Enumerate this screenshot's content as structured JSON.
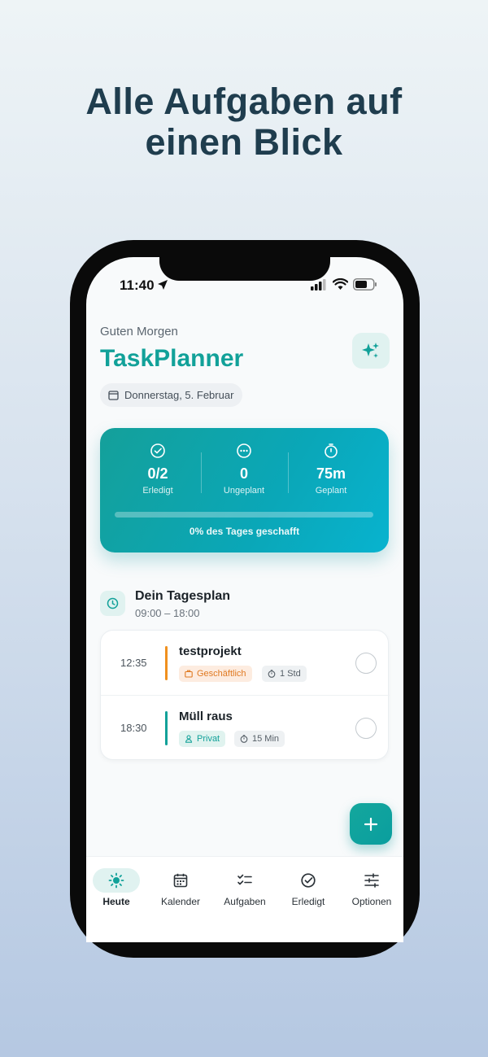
{
  "headline": {
    "line1": "Alle Aufgaben auf",
    "line2": "einen Blick"
  },
  "status_bar": {
    "time": "11:40"
  },
  "header": {
    "greeting": "Guten Morgen",
    "title": "TaskPlanner",
    "date": "Donnerstag, 5. Februar"
  },
  "stats": {
    "done": {
      "value": "0/2",
      "label": "Erledigt"
    },
    "unplanned": {
      "value": "0",
      "label": "Ungeplant"
    },
    "planned": {
      "value": "75m",
      "label": "Geplant"
    },
    "progress_percent": 0,
    "progress_text": "0% des Tages geschafft"
  },
  "day_plan": {
    "title": "Dein Tagesplan",
    "range": "09:00 – 18:00",
    "tasks": [
      {
        "time": "12:35",
        "name": "testprojekt",
        "category": "Geschäftlich",
        "duration": "1 Std",
        "color": "#f0901e"
      },
      {
        "time": "18:30",
        "name": "Müll raus",
        "category": "Privat",
        "duration": "15 Min",
        "color": "#12a199"
      }
    ]
  },
  "nav": {
    "items": [
      {
        "label": "Heute",
        "icon": "sun-icon"
      },
      {
        "label": "Kalender",
        "icon": "calendar-icon"
      },
      {
        "label": "Aufgaben",
        "icon": "checklist-icon"
      },
      {
        "label": "Erledigt",
        "icon": "check-circle-icon"
      },
      {
        "label": "Optionen",
        "icon": "sliders-icon"
      }
    ]
  },
  "colors": {
    "accent": "#12a199",
    "orange": "#f0901e",
    "headline": "#1f3d4e"
  }
}
